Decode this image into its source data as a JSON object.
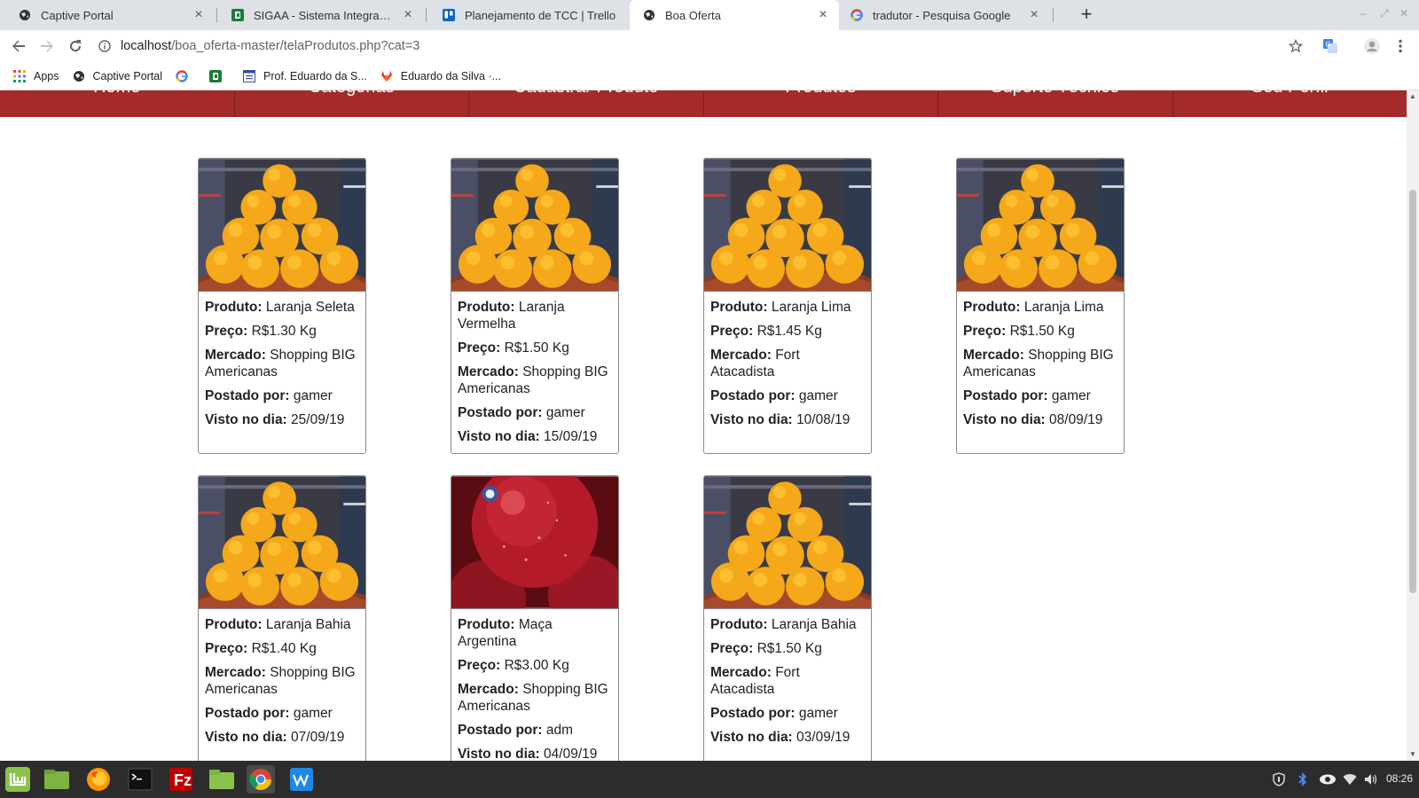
{
  "browser": {
    "tabs": [
      {
        "title": "Captive Portal",
        "icon": "globe-icon"
      },
      {
        "title": "SIGAA - Sistema Integrado de G",
        "icon": "sigaa-icon"
      },
      {
        "title": "Planejamento de TCC | Trello",
        "icon": "trello-icon"
      },
      {
        "title": "Boa Oferta",
        "icon": "globe-icon",
        "active": true
      },
      {
        "title": "tradutor - Pesquisa Google",
        "icon": "google-icon"
      }
    ],
    "url": {
      "host": "localhost",
      "path": "/boa_oferta-master/telaProdutos.php?cat=3"
    },
    "bookmarks": [
      {
        "label": "Apps",
        "icon": "apps-grid-icon"
      },
      {
        "label": "Captive Portal",
        "icon": "globe-icon"
      },
      {
        "label": "",
        "icon": "google-icon"
      },
      {
        "label": "",
        "icon": "sigaa-icon"
      },
      {
        "label": "Prof. Eduardo da S...",
        "icon": "page-icon"
      },
      {
        "label": "Eduardo da Silva ·...",
        "icon": "gitlab-icon"
      }
    ]
  },
  "site": {
    "nav": [
      "Home",
      "Categorias",
      "Cadastrar Produto",
      "Produtos",
      "Suporte Técnico",
      "Seu Perfil"
    ],
    "labels": {
      "produto": "Produto:",
      "preco": "Preço:",
      "mercado": "Mercado:",
      "postado": "Postado por:",
      "visto": "Visto no dia:"
    },
    "products": [
      {
        "name": "Laranja Seleta",
        "price": "R$1.30 Kg",
        "market": "Shopping BIG Americanas",
        "user": "gamer",
        "date": "25/09/19",
        "image": "oranges"
      },
      {
        "name": "Laranja Vermelha",
        "price": "R$1.50 Kg",
        "market": "Shopping BIG Americanas",
        "user": "gamer",
        "date": "15/09/19",
        "image": "oranges"
      },
      {
        "name": "Laranja Lima",
        "price": "R$1.45 Kg",
        "market": "Fort Atacadista",
        "user": "gamer",
        "date": "10/08/19",
        "image": "oranges"
      },
      {
        "name": "Laranja Lima",
        "price": "R$1.50 Kg",
        "market": "Shopping BIG Americanas",
        "user": "gamer",
        "date": "08/09/19",
        "image": "oranges"
      },
      {
        "name": "Laranja Bahia",
        "price": "R$1.40 Kg",
        "market": "Shopping BIG Americanas",
        "user": "gamer",
        "date": "07/09/19",
        "image": "oranges"
      },
      {
        "name": "Maça Argentina",
        "price": "R$3.00 Kg",
        "market": "Shopping BIG Americanas",
        "user": "adm",
        "date": "04/09/19",
        "image": "apples"
      },
      {
        "name": "Laranja Bahia",
        "price": "R$1.50 Kg",
        "market": "Fort Atacadista",
        "user": "gamer",
        "date": "03/09/19",
        "image": "oranges"
      }
    ]
  },
  "taskbar": {
    "apps": [
      "mint-menu-icon",
      "show-desktop-icon",
      "firefox-icon",
      "terminal-icon",
      "filezilla-icon",
      "files-icon",
      "chrome-icon",
      "workbench-icon"
    ],
    "clock": "08:26"
  },
  "colors": {
    "nav_bg": "#a52a2a",
    "taskbar_bg": "#2c2c2c"
  }
}
